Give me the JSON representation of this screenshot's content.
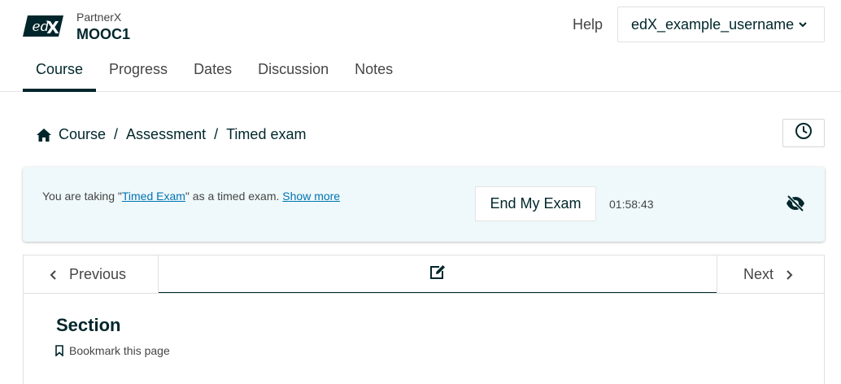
{
  "header": {
    "logo_text": "edX",
    "org": "PartnerX",
    "course": "MOOC1",
    "help": "Help",
    "username": "edX_example_username"
  },
  "tabs": [
    {
      "label": "Course",
      "active": true
    },
    {
      "label": "Progress",
      "active": false
    },
    {
      "label": "Dates",
      "active": false
    },
    {
      "label": "Discussion",
      "active": false
    },
    {
      "label": "Notes",
      "active": false
    }
  ],
  "breadcrumb": {
    "items": [
      "Course",
      "Assessment",
      "Timed exam"
    ],
    "separator": "/"
  },
  "exam_banner": {
    "prefix": "You are taking \"",
    "exam_link": "Timed Exam",
    "suffix": "\" as a timed exam.",
    "show_more": "Show more",
    "end_button": "End My Exam",
    "timer": "01:58:43"
  },
  "unit_nav": {
    "previous": "Previous",
    "next": "Next"
  },
  "content": {
    "section_title": "Section",
    "bookmark": "Bookmark this page"
  },
  "colors": {
    "primary": "#00262b",
    "link": "#0075b4",
    "banner_bg": "#eff8fa"
  },
  "icons": [
    "home-icon",
    "clock-icon",
    "eye-slash-icon",
    "chevron-left-icon",
    "chevron-right-icon",
    "edit-icon",
    "bookmark-icon",
    "chevron-down-icon"
  ]
}
